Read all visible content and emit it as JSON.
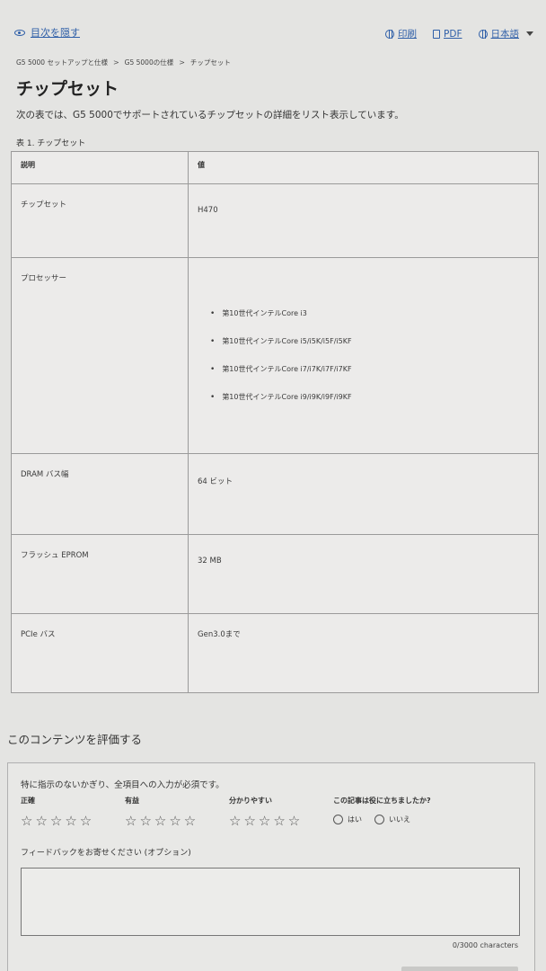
{
  "toolbar": {
    "toc_toggle": "目次を隠す",
    "print": "印刷",
    "pdf": "PDF",
    "language": "日本語"
  },
  "breadcrumb": {
    "items": [
      "G5 5000 セットアップと仕様",
      "G5 5000の仕様",
      "チップセット"
    ],
    "separator": ">"
  },
  "page": {
    "title": "チップセット",
    "intro": "次の表では、G5 5000でサポートされているチップセットの詳細をリスト表示しています。",
    "table_caption": "表 1. チップセット"
  },
  "table": {
    "headers": [
      "説明",
      "値"
    ],
    "rows": [
      {
        "label": "チップセット",
        "value": "H470"
      },
      {
        "label": "プロセッサー",
        "values": [
          "第10世代インテルCore i3",
          "第10世代インテルCore i5/i5K/i5F/i5KF",
          "第10世代インテルCore i7/i7K/i7F/i7KF",
          "第10世代インテルCore i9/i9K/i9F/i9KF"
        ]
      },
      {
        "label": "DRAM バス幅",
        "value": "64 ビット"
      },
      {
        "label": "フラッシュ EPROM",
        "value": "32 MB"
      },
      {
        "label": "PCIe バス",
        "value": "Gen3.0まで"
      }
    ]
  },
  "rating": {
    "heading": "このコンテンツを評価する",
    "required_note": "特に指示のないかぎり、全項目への入力が必須です。",
    "criteria": [
      "正確",
      "有益",
      "分かりやすい"
    ],
    "stars": "☆☆☆☆☆",
    "helpful_question": "この記事は役に立ちましたか?",
    "yes": "はい",
    "no": "いいえ",
    "feedback_label": "フィードバックをお寄せください (オプション)",
    "char_count": "0/3000 characters"
  },
  "colors": {
    "link": "#2f5fa8",
    "background": "#e4e4e2",
    "border": "#9a9a9a"
  }
}
